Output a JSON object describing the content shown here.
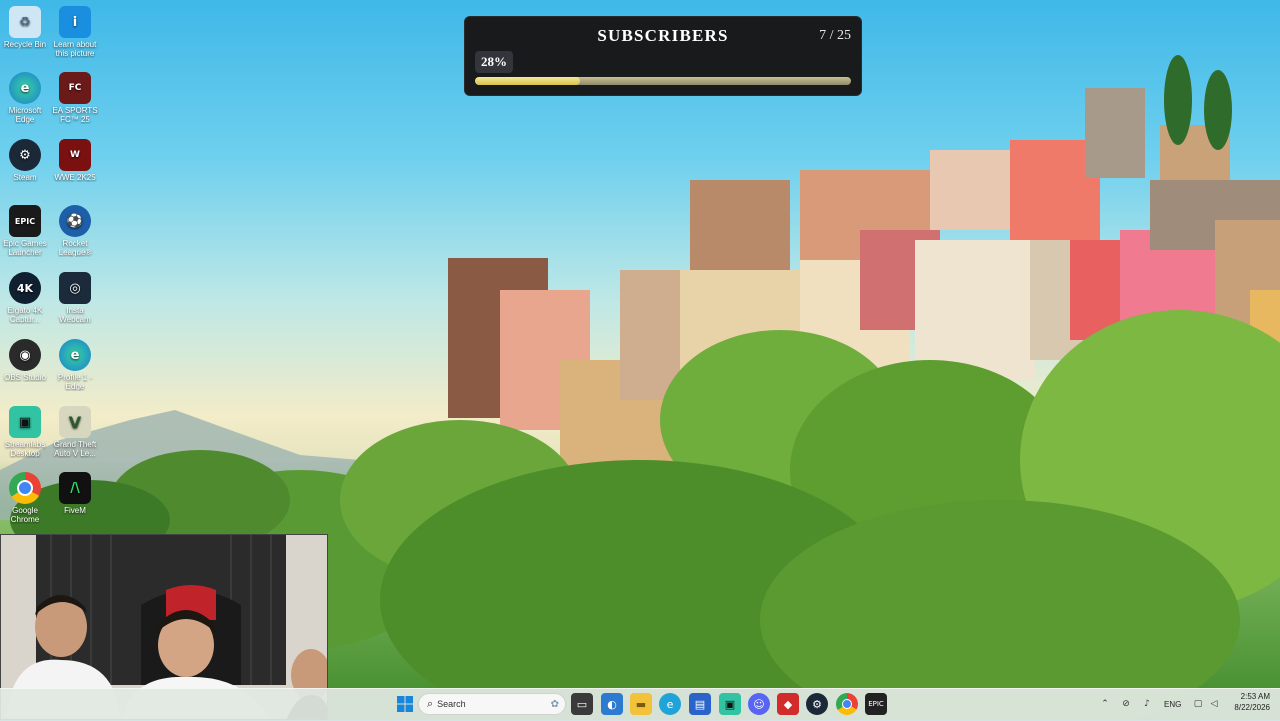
{
  "desktop": {
    "icons": [
      {
        "label": "Recycle Bin",
        "icon": "recycle-bin-icon",
        "color": "#cfe6f5"
      },
      {
        "label": "Learn about this picture",
        "icon": "info-icon",
        "color": "#1a8fe0"
      },
      {
        "label": "Microsoft Edge",
        "icon": "edge-icon",
        "color": "#1fa3d9"
      },
      {
        "label": "EA SPORTS FC™ 25",
        "icon": "ea-fc-icon",
        "color": "#6b1a1a"
      },
      {
        "label": "Steam",
        "icon": "steam-icon",
        "color": "#1b2838"
      },
      {
        "label": "WWE 2K25",
        "icon": "wwe-icon",
        "color": "#7a1010"
      },
      {
        "label": "Epic Games Launcher",
        "icon": "epic-games-icon",
        "color": "#1a1a1a"
      },
      {
        "label": "Rocket League®",
        "icon": "rocket-league-icon",
        "color": "#1d5fa8"
      },
      {
        "label": "Elgato 4K Captur...",
        "icon": "elgato-icon",
        "color": "#102030"
      },
      {
        "label": "Insta Webcam",
        "icon": "webcam-icon",
        "color": "#1c2b3c"
      },
      {
        "label": "OBS Studio",
        "icon": "obs-icon",
        "color": "#2a2a2a"
      },
      {
        "label": "Profile 1 - Edge",
        "icon": "edge-profile-icon",
        "color": "#1fa3d9"
      },
      {
        "label": "Streamlabs Desktop",
        "icon": "streamlabs-icon",
        "color": "#31c3a2"
      },
      {
        "label": "Grand Theft Auto V Le...",
        "icon": "gta-icon",
        "color": "#d7d7c0"
      },
      {
        "label": "Google Chrome",
        "icon": "chrome-icon",
        "color": "#e5e5e5"
      },
      {
        "label": "FiveM",
        "icon": "fivem-icon",
        "color": "#111111"
      }
    ]
  },
  "goal_widget": {
    "title": "SUBSCRIBERS",
    "count": "7 / 25",
    "percent_label": "28%",
    "progress": 0.28
  },
  "taskbar": {
    "search_label": "Search",
    "language": "ENG",
    "time": "2:53 AM",
    "date": "8/22/2026",
    "apps": [
      "start-icon",
      "widgets-icon",
      "task-view-icon",
      "browser-icon",
      "file-explorer-icon",
      "edge-icon",
      "store-icon",
      "streamlabs-icon",
      "discord-icon",
      "media-icon",
      "steam-icon",
      "chrome-icon",
      "epic-games-icon"
    ],
    "tray": [
      "chevron-up-icon",
      "network-icon",
      "microphone-icon",
      "wifi-icon",
      "volume-icon"
    ]
  }
}
